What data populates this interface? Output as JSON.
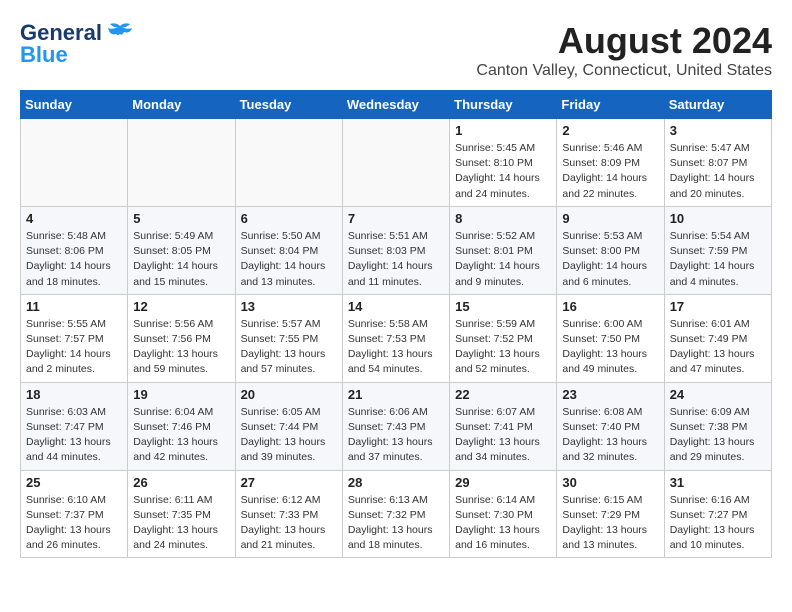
{
  "header": {
    "logo_line1": "General",
    "logo_line2": "Blue",
    "title": "August 2024",
    "subtitle": "Canton Valley, Connecticut, United States"
  },
  "weekdays": [
    "Sunday",
    "Monday",
    "Tuesday",
    "Wednesday",
    "Thursday",
    "Friday",
    "Saturday"
  ],
  "weeks": [
    [
      {
        "day": "",
        "info": ""
      },
      {
        "day": "",
        "info": ""
      },
      {
        "day": "",
        "info": ""
      },
      {
        "day": "",
        "info": ""
      },
      {
        "day": "1",
        "info": "Sunrise: 5:45 AM\nSunset: 8:10 PM\nDaylight: 14 hours\nand 24 minutes."
      },
      {
        "day": "2",
        "info": "Sunrise: 5:46 AM\nSunset: 8:09 PM\nDaylight: 14 hours\nand 22 minutes."
      },
      {
        "day": "3",
        "info": "Sunrise: 5:47 AM\nSunset: 8:07 PM\nDaylight: 14 hours\nand 20 minutes."
      }
    ],
    [
      {
        "day": "4",
        "info": "Sunrise: 5:48 AM\nSunset: 8:06 PM\nDaylight: 14 hours\nand 18 minutes."
      },
      {
        "day": "5",
        "info": "Sunrise: 5:49 AM\nSunset: 8:05 PM\nDaylight: 14 hours\nand 15 minutes."
      },
      {
        "day": "6",
        "info": "Sunrise: 5:50 AM\nSunset: 8:04 PM\nDaylight: 14 hours\nand 13 minutes."
      },
      {
        "day": "7",
        "info": "Sunrise: 5:51 AM\nSunset: 8:03 PM\nDaylight: 14 hours\nand 11 minutes."
      },
      {
        "day": "8",
        "info": "Sunrise: 5:52 AM\nSunset: 8:01 PM\nDaylight: 14 hours\nand 9 minutes."
      },
      {
        "day": "9",
        "info": "Sunrise: 5:53 AM\nSunset: 8:00 PM\nDaylight: 14 hours\nand 6 minutes."
      },
      {
        "day": "10",
        "info": "Sunrise: 5:54 AM\nSunset: 7:59 PM\nDaylight: 14 hours\nand 4 minutes."
      }
    ],
    [
      {
        "day": "11",
        "info": "Sunrise: 5:55 AM\nSunset: 7:57 PM\nDaylight: 14 hours\nand 2 minutes."
      },
      {
        "day": "12",
        "info": "Sunrise: 5:56 AM\nSunset: 7:56 PM\nDaylight: 13 hours\nand 59 minutes."
      },
      {
        "day": "13",
        "info": "Sunrise: 5:57 AM\nSunset: 7:55 PM\nDaylight: 13 hours\nand 57 minutes."
      },
      {
        "day": "14",
        "info": "Sunrise: 5:58 AM\nSunset: 7:53 PM\nDaylight: 13 hours\nand 54 minutes."
      },
      {
        "day": "15",
        "info": "Sunrise: 5:59 AM\nSunset: 7:52 PM\nDaylight: 13 hours\nand 52 minutes."
      },
      {
        "day": "16",
        "info": "Sunrise: 6:00 AM\nSunset: 7:50 PM\nDaylight: 13 hours\nand 49 minutes."
      },
      {
        "day": "17",
        "info": "Sunrise: 6:01 AM\nSunset: 7:49 PM\nDaylight: 13 hours\nand 47 minutes."
      }
    ],
    [
      {
        "day": "18",
        "info": "Sunrise: 6:03 AM\nSunset: 7:47 PM\nDaylight: 13 hours\nand 44 minutes."
      },
      {
        "day": "19",
        "info": "Sunrise: 6:04 AM\nSunset: 7:46 PM\nDaylight: 13 hours\nand 42 minutes."
      },
      {
        "day": "20",
        "info": "Sunrise: 6:05 AM\nSunset: 7:44 PM\nDaylight: 13 hours\nand 39 minutes."
      },
      {
        "day": "21",
        "info": "Sunrise: 6:06 AM\nSunset: 7:43 PM\nDaylight: 13 hours\nand 37 minutes."
      },
      {
        "day": "22",
        "info": "Sunrise: 6:07 AM\nSunset: 7:41 PM\nDaylight: 13 hours\nand 34 minutes."
      },
      {
        "day": "23",
        "info": "Sunrise: 6:08 AM\nSunset: 7:40 PM\nDaylight: 13 hours\nand 32 minutes."
      },
      {
        "day": "24",
        "info": "Sunrise: 6:09 AM\nSunset: 7:38 PM\nDaylight: 13 hours\nand 29 minutes."
      }
    ],
    [
      {
        "day": "25",
        "info": "Sunrise: 6:10 AM\nSunset: 7:37 PM\nDaylight: 13 hours\nand 26 minutes."
      },
      {
        "day": "26",
        "info": "Sunrise: 6:11 AM\nSunset: 7:35 PM\nDaylight: 13 hours\nand 24 minutes."
      },
      {
        "day": "27",
        "info": "Sunrise: 6:12 AM\nSunset: 7:33 PM\nDaylight: 13 hours\nand 21 minutes."
      },
      {
        "day": "28",
        "info": "Sunrise: 6:13 AM\nSunset: 7:32 PM\nDaylight: 13 hours\nand 18 minutes."
      },
      {
        "day": "29",
        "info": "Sunrise: 6:14 AM\nSunset: 7:30 PM\nDaylight: 13 hours\nand 16 minutes."
      },
      {
        "day": "30",
        "info": "Sunrise: 6:15 AM\nSunset: 7:29 PM\nDaylight: 13 hours\nand 13 minutes."
      },
      {
        "day": "31",
        "info": "Sunrise: 6:16 AM\nSunset: 7:27 PM\nDaylight: 13 hours\nand 10 minutes."
      }
    ]
  ]
}
